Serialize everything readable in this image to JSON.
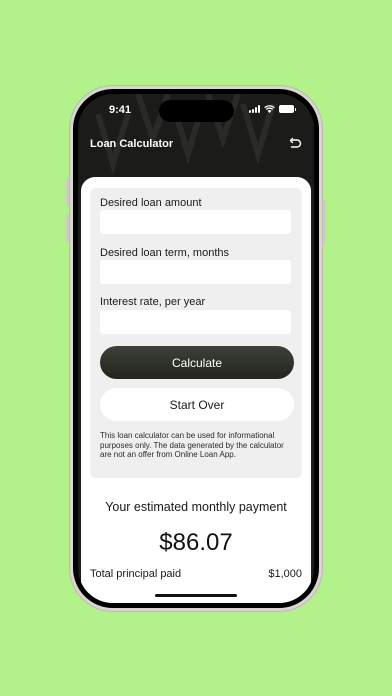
{
  "status_bar": {
    "time": "9:41"
  },
  "nav": {
    "title": "Loan Calculator",
    "action_icon": "reset-arrow-icon"
  },
  "form": {
    "loan_amount": {
      "label": "Desired loan amount",
      "value": ""
    },
    "loan_term": {
      "label": "Desired loan term, months",
      "value": ""
    },
    "interest_rate": {
      "label": "Interest rate, per year",
      "value": ""
    },
    "calculate_label": "Calculate",
    "start_over_label": "Start Over",
    "disclaimer": "This loan calculator can be used for informational purposes only. The data generated by the calculator are not an offer from Online Loan App."
  },
  "result": {
    "heading": "Your estimated monthly payment",
    "monthly_payment": "$86.07",
    "total_principal_label": "Total principal paid",
    "total_principal_value": "$1,000"
  },
  "colors": {
    "background": "#b3f28a",
    "header": "#1b1b19",
    "calculate_button": "#2e3129",
    "form_card": "#efefef"
  }
}
